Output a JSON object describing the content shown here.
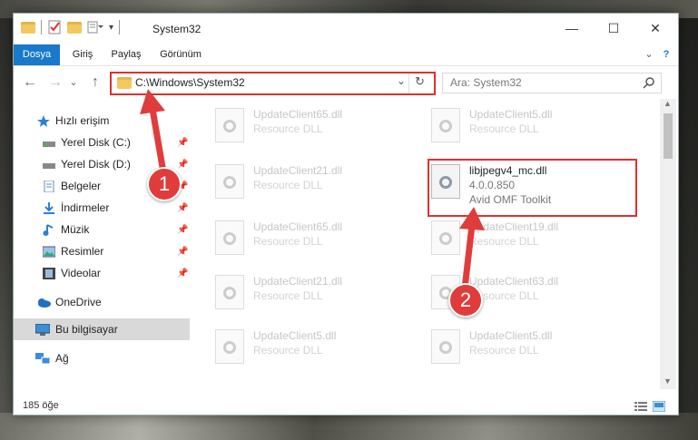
{
  "window": {
    "title": "System32"
  },
  "controls": {
    "minimize": "—",
    "maximize": "☐",
    "close": "✕",
    "help": "?"
  },
  "ribbon": {
    "tabs": [
      "Dosya",
      "Giriş",
      "Paylaş",
      "Görünüm"
    ],
    "active": "Dosya",
    "expand": "⌄"
  },
  "nav": {
    "back": "←",
    "forward": "→",
    "recent": "⌄",
    "up": "↑"
  },
  "address": {
    "path": "C:\\Windows\\System32",
    "dropdown": "⌄",
    "refresh": "↻"
  },
  "search": {
    "placeholder": "Ara: System32",
    "icon": "magnifier-icon"
  },
  "sidebar": {
    "items": [
      {
        "label": "Hızlı erişim",
        "icon": "star-icon",
        "pinned": false
      },
      {
        "label": "Yerel Disk (C:)",
        "icon": "drive-icon",
        "pinned": true
      },
      {
        "label": "Yerel Disk (D:)",
        "icon": "drive-icon",
        "pinned": true
      },
      {
        "label": "Belgeler",
        "icon": "document-icon",
        "pinned": true
      },
      {
        "label": "İndirmeler",
        "icon": "download-icon",
        "pinned": true
      },
      {
        "label": "Müzik",
        "icon": "music-icon",
        "pinned": true
      },
      {
        "label": "Resimler",
        "icon": "pictures-icon",
        "pinned": true
      },
      {
        "label": "Videolar",
        "icon": "video-icon",
        "pinned": true
      },
      {
        "label": "OneDrive",
        "icon": "cloud-icon",
        "pinned": false
      },
      {
        "label": "Bu bilgisayar",
        "icon": "computer-icon",
        "pinned": false,
        "selected": true
      },
      {
        "label": "Ağ",
        "icon": "network-icon",
        "pinned": false
      }
    ]
  },
  "files": [
    {
      "name": "UpdateClient65.dll",
      "desc": "Resource DLL"
    },
    {
      "name": "UpdateClient5.dll",
      "desc": "Resource DLL"
    },
    {
      "name": "UpdateClient21.dll",
      "desc": "Resource DLL"
    },
    {
      "name": "libjpegv4_mc.dll",
      "version": "4.0.0.850",
      "desc": "Avid OMF Toolkit",
      "highlighted": true
    },
    {
      "name": "UpdateClient65.dll",
      "desc": "Resource DLL"
    },
    {
      "name": "UpdateClient19.dll",
      "desc": "Resource DLL"
    },
    {
      "name": "UpdateClient21.dll",
      "desc": "Resource DLL"
    },
    {
      "name": "UpdateClient63.dll",
      "desc": "Resource DLL"
    },
    {
      "name": "UpdateClient5.dll",
      "desc": "Resource DLL"
    },
    {
      "name": "UpdateClient5.dll",
      "desc": "Resource DLL"
    }
  ],
  "status": {
    "count": "185 öğe"
  },
  "annotations": {
    "step1": "1",
    "step2": "2"
  },
  "colors": {
    "accent": "#1979ca",
    "highlight": "#e03030"
  }
}
